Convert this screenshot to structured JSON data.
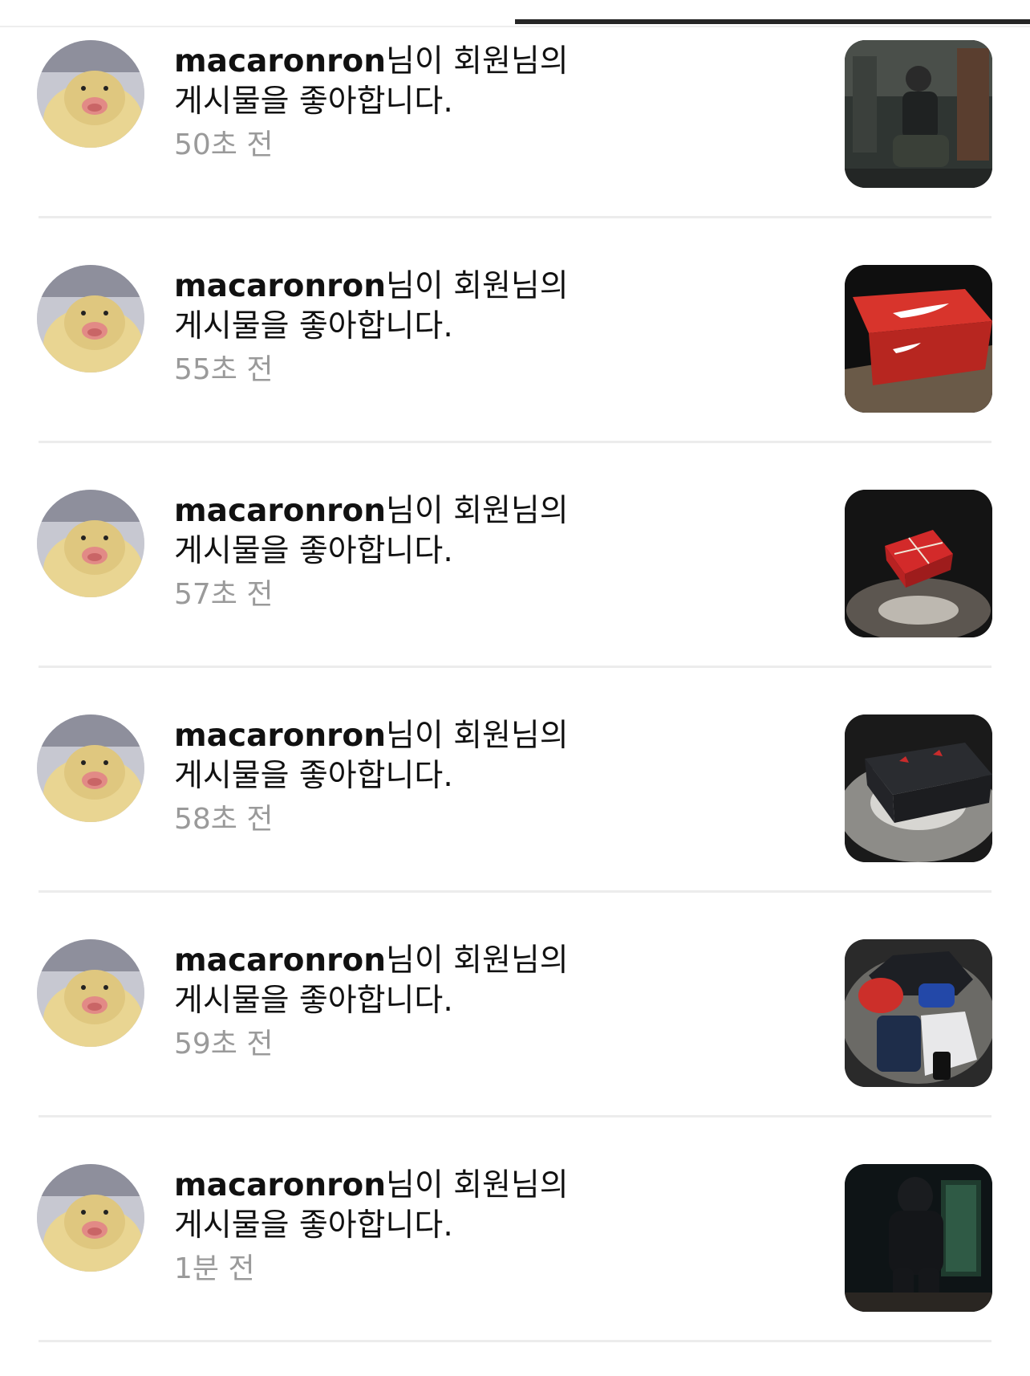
{
  "notifications": [
    {
      "username": "macaronron",
      "action_line1": "님이 회원님의",
      "action_line2": "게시물을 좋아합니다.",
      "time": "50초 전",
      "avatar_icon": "duckling-avatar-icon",
      "thumbnail": "person-crouching-photo"
    },
    {
      "username": "macaronron",
      "action_line1": "님이 회원님의",
      "action_line2": "게시물을 좋아합니다.",
      "time": "55초 전",
      "avatar_icon": "duckling-avatar-icon",
      "thumbnail": "nike-shoebox-photo"
    },
    {
      "username": "macaronron",
      "action_line1": "님이 회원님의",
      "action_line2": "게시물을 좋아합니다.",
      "time": "57초 전",
      "avatar_icon": "duckling-avatar-icon",
      "thumbnail": "red-gift-box-photo"
    },
    {
      "username": "macaronron",
      "action_line1": "님이 회원님의",
      "action_line2": "게시물을 좋아합니다.",
      "time": "58초 전",
      "avatar_icon": "duckling-avatar-icon",
      "thumbnail": "black-shoebox-photo"
    },
    {
      "username": "macaronron",
      "action_line1": "님이 회원님의",
      "action_line2": "게시물을 좋아합니다.",
      "time": "59초 전",
      "avatar_icon": "duckling-avatar-icon",
      "thumbnail": "clothing-flatlay-photo"
    },
    {
      "username": "macaronron",
      "action_line1": "님이 회원님의",
      "action_line2": "게시물을 좋아합니다.",
      "time": "1분 전",
      "avatar_icon": "duckling-avatar-icon",
      "thumbnail": "black-jacket-photo"
    }
  ]
}
